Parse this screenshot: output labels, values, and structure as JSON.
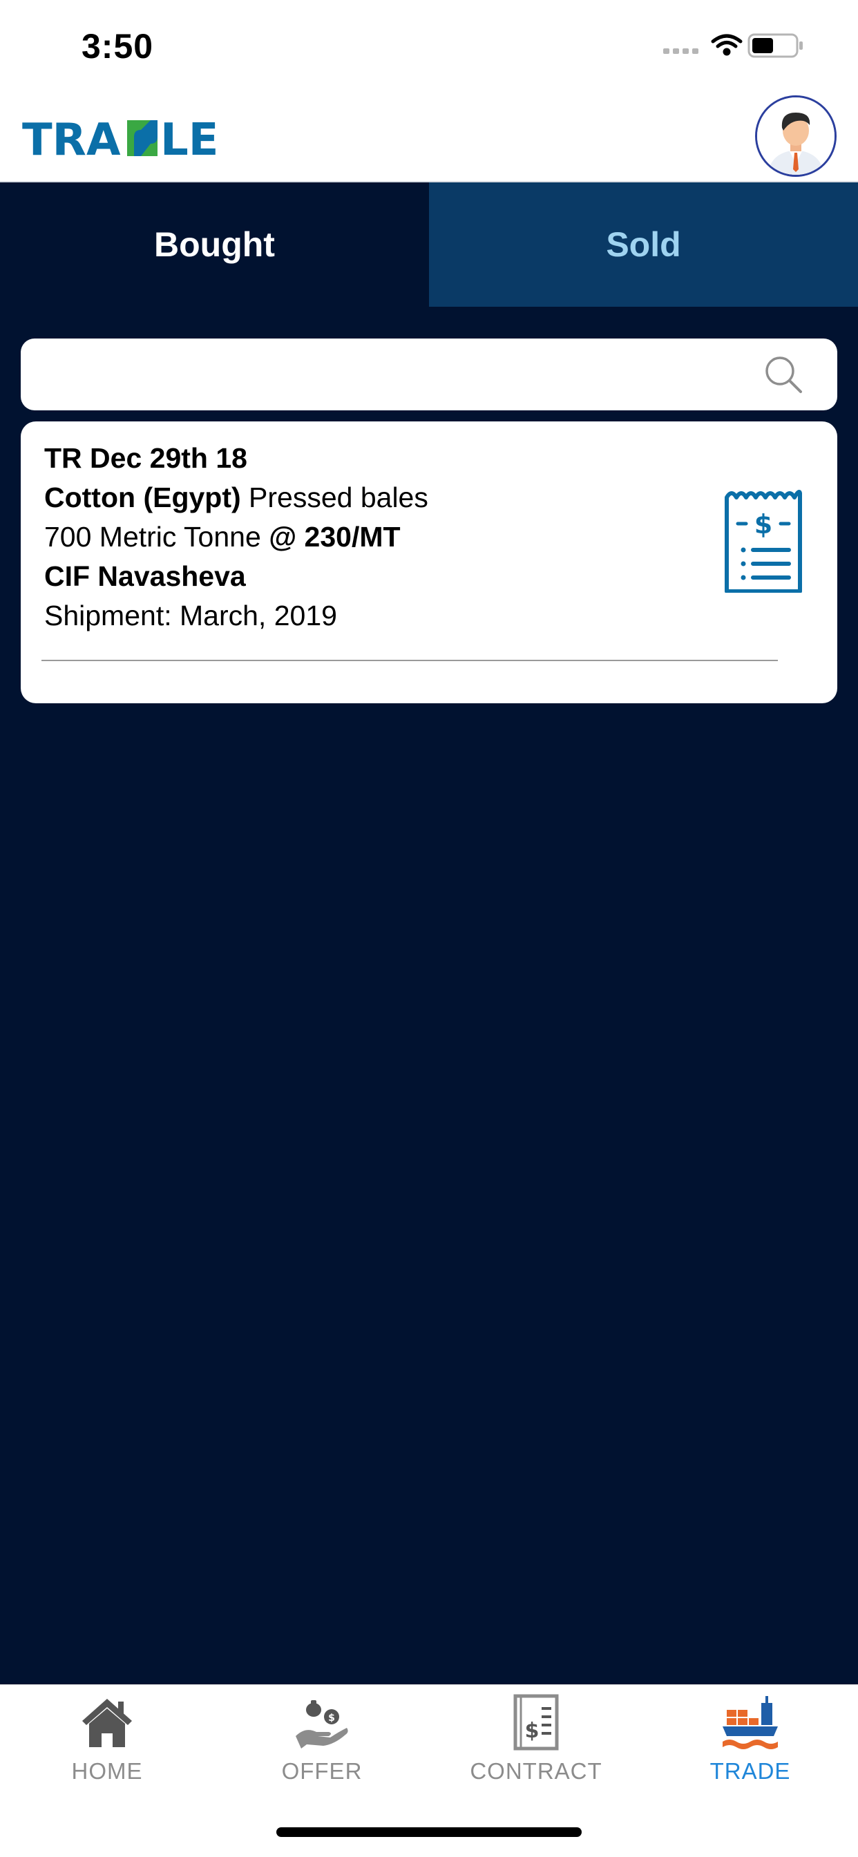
{
  "status_bar": {
    "time": "3:50"
  },
  "header": {
    "logo_text": "TRADLE"
  },
  "tabs": [
    {
      "label": "Bought",
      "active": true
    },
    {
      "label": "Sold",
      "active": false
    }
  ],
  "search": {
    "value": "",
    "placeholder": ""
  },
  "trade_card": {
    "ref": "TR Dec 29th 18",
    "commodity": "Cotton (Egypt)",
    "packing": "Pressed bales",
    "quantity": "700 Metric Tonne",
    "price": "@ 230/MT",
    "terms": "CIF Navasheva",
    "shipment_label": "Shipment:",
    "shipment_value": "March, 2019"
  },
  "nav": [
    {
      "label": "HOME",
      "icon": "home-icon"
    },
    {
      "label": "OFFER",
      "icon": "offer-icon"
    },
    {
      "label": "CONTRACT",
      "icon": "contract-icon"
    },
    {
      "label": "TRADE",
      "icon": "trade-icon",
      "active": true
    }
  ],
  "colors": {
    "background": "#011230",
    "tab_sold": "#0a3a66",
    "accent": "#1f86d9",
    "logo_blue": "#0b6fa8",
    "logo_green": "#3aa843"
  }
}
